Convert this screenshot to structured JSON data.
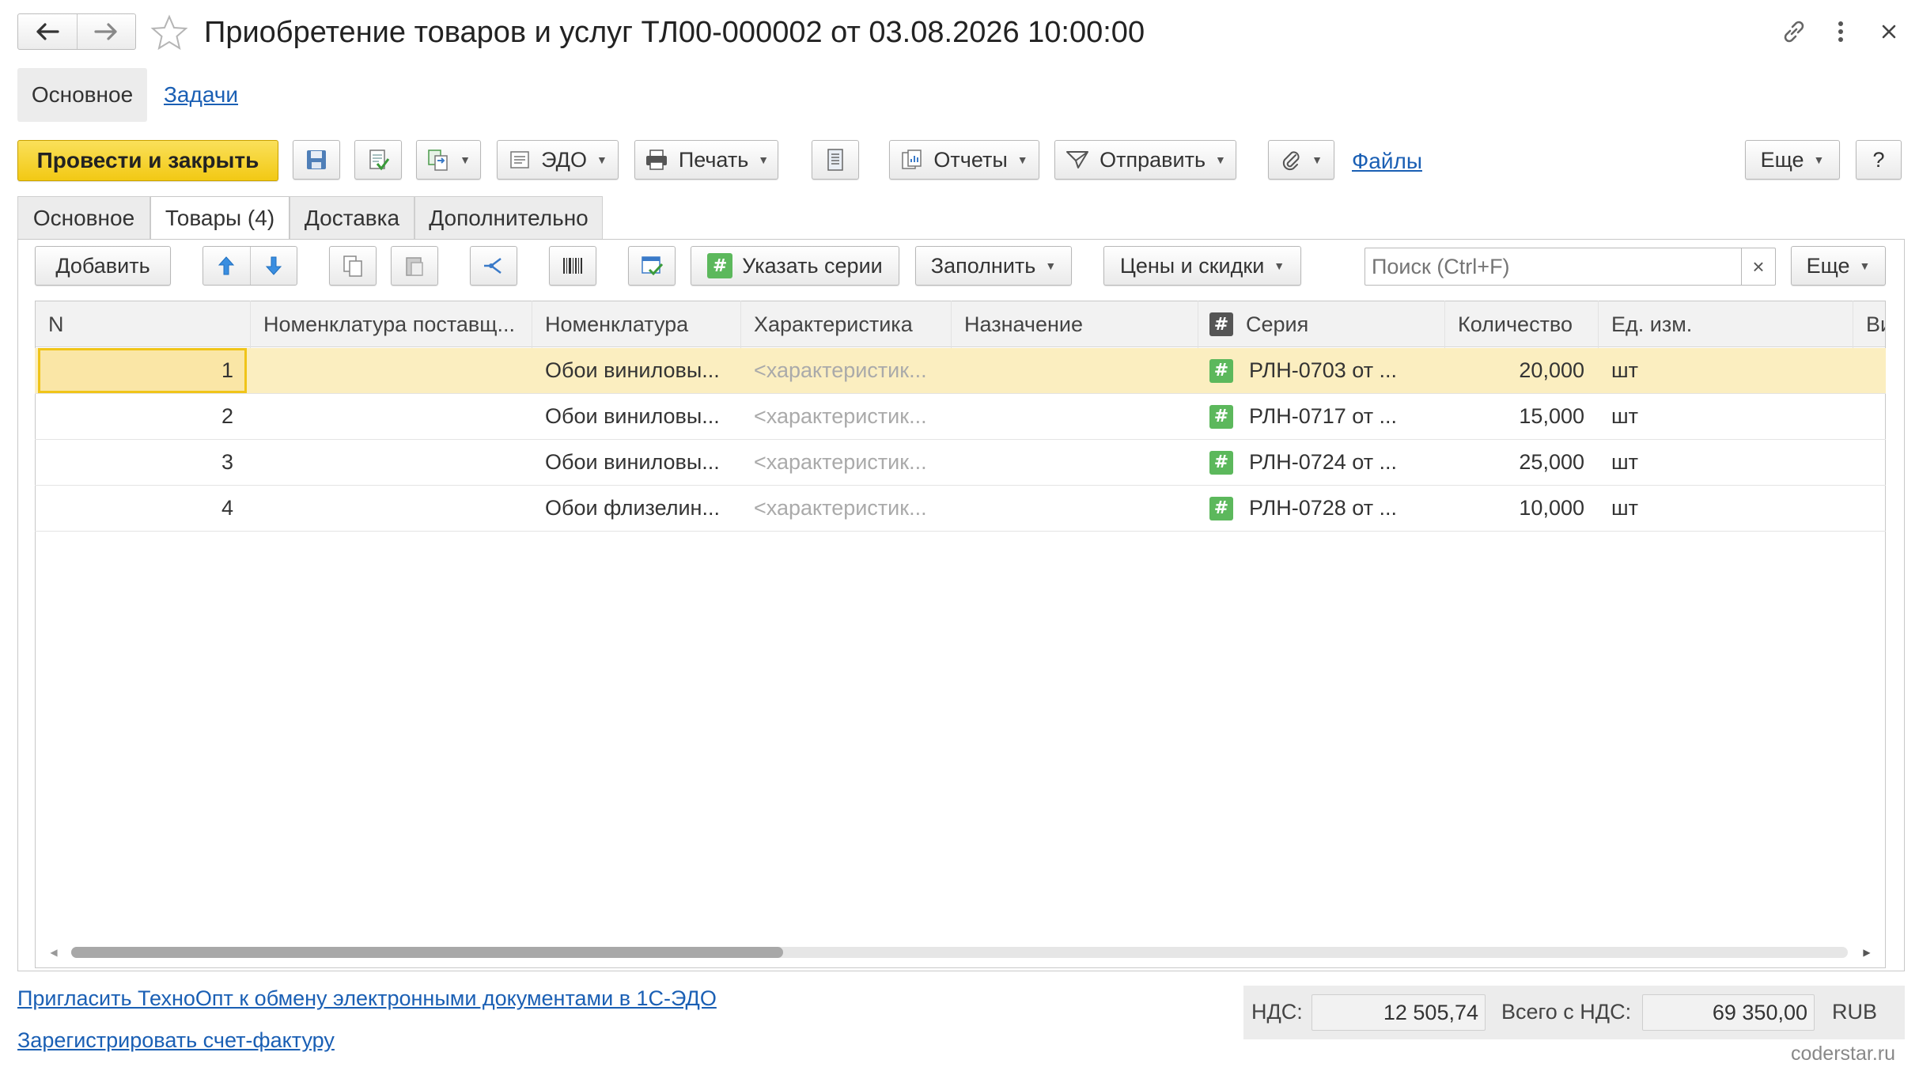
{
  "window": {
    "title": "Приобретение товаров и услуг ТЛ00-000002 от 03.08.2026 10:00:00"
  },
  "nav": {
    "main": "Основное",
    "tasks": "Задачи"
  },
  "toolbar": {
    "post_close": "Провести и закрыть",
    "edo": "ЭДО",
    "print": "Печать",
    "reports": "Отчеты",
    "send": "Отправить",
    "files": "Файлы",
    "more": "Еще",
    "help": "?"
  },
  "tabs": [
    {
      "label": "Основное"
    },
    {
      "label": "Товары (4)"
    },
    {
      "label": "Доставка"
    },
    {
      "label": "Дополнительно"
    }
  ],
  "goods_toolbar": {
    "add": "Добавить",
    "series": "Указать серии",
    "fill": "Заполнить",
    "prices": "Цены и скидки",
    "search_placeholder": "Поиск (Ctrl+F)",
    "clear": "×",
    "more": "Еще"
  },
  "table": {
    "columns": [
      "N",
      "Номенклатура поставщ...",
      "Номенклатура",
      "Характеристика",
      "Назначение",
      "#",
      "Серия",
      "Количество",
      "Ед. изм.",
      "Ви"
    ],
    "rows": [
      {
        "n": "1",
        "supplier_item": "",
        "item": "Обои виниловы...",
        "characteristic": "<характеристик...",
        "purpose": "",
        "series": "РЛН-0703 от ...",
        "qty": "20,000",
        "unit": "шт"
      },
      {
        "n": "2",
        "supplier_item": "",
        "item": "Обои виниловы...",
        "characteristic": "<характеристик...",
        "purpose": "",
        "series": "РЛН-0717 от ...",
        "qty": "15,000",
        "unit": "шт"
      },
      {
        "n": "3",
        "supplier_item": "",
        "item": "Обои виниловы...",
        "characteristic": "<характеристик...",
        "purpose": "",
        "series": "РЛН-0724 от ...",
        "qty": "25,000",
        "unit": "шт"
      },
      {
        "n": "4",
        "supplier_item": "",
        "item": "Обои флизелин...",
        "characteristic": "<характеристик...",
        "purpose": "",
        "series": "РЛН-0728 от ...",
        "qty": "10,000",
        "unit": "шт"
      }
    ]
  },
  "footer": {
    "invite_link": "Пригласить ТехноОпт к обмену электронными документами в 1С-ЭДО",
    "register_link": "Зарегистрировать счет-фактуру",
    "vat_label": "НДС:",
    "vat_value": "12 505,74",
    "total_label": "Всего с НДС:",
    "total_value": "69 350,00",
    "currency": "RUB",
    "watermark": "coderstar.ru"
  },
  "colors": {
    "primary_button": "#f5d229",
    "selected_row": "#fbeec0",
    "link": "#1a5fb4",
    "series_icon": "#5cb85c"
  }
}
